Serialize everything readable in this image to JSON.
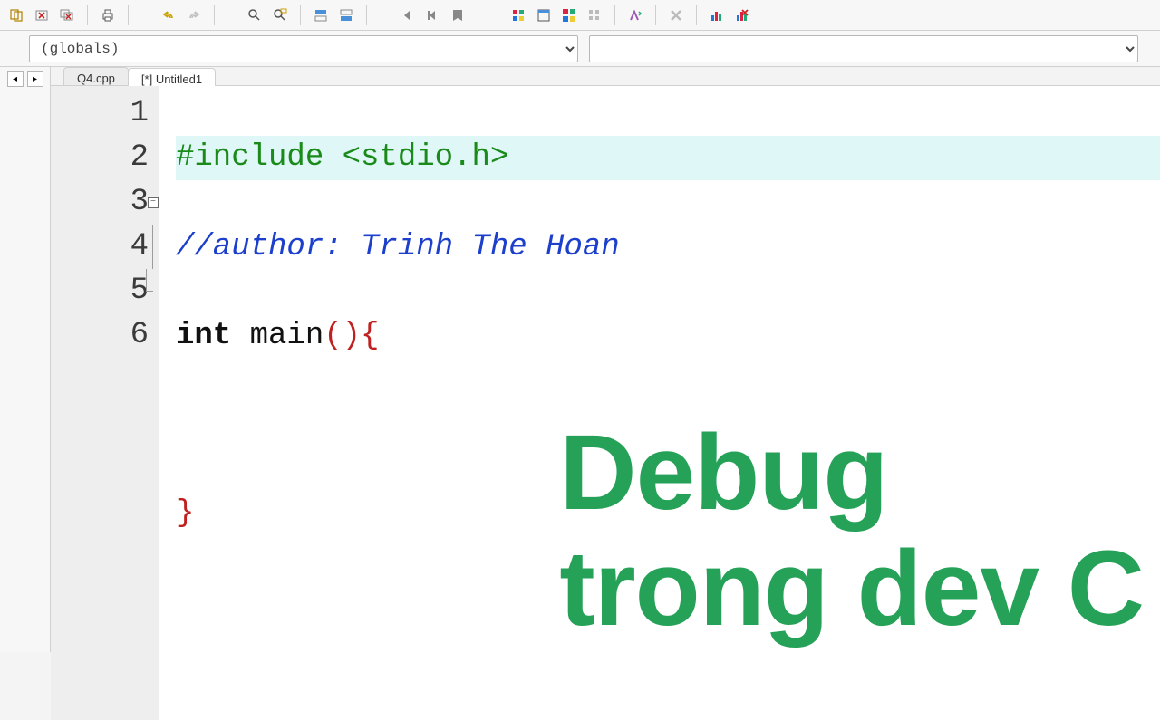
{
  "toolbar": {
    "scope_value": "(globals)"
  },
  "tabs": [
    {
      "label": "Q4.cpp",
      "active": false
    },
    {
      "label": "[*] Untitled1",
      "active": true
    }
  ],
  "code": {
    "lines": [
      "1",
      "2",
      "3",
      "4",
      "5",
      "6"
    ],
    "l1_pp": "#include <stdio.h>",
    "l2_com": "//author: Trinh The Hoan",
    "l3_kw": "int",
    "l3_fn": " main",
    "l3_par": "(){",
    "l5_close": "}"
  },
  "overlay": {
    "line1": "Debug",
    "line2": "trong dev C"
  }
}
